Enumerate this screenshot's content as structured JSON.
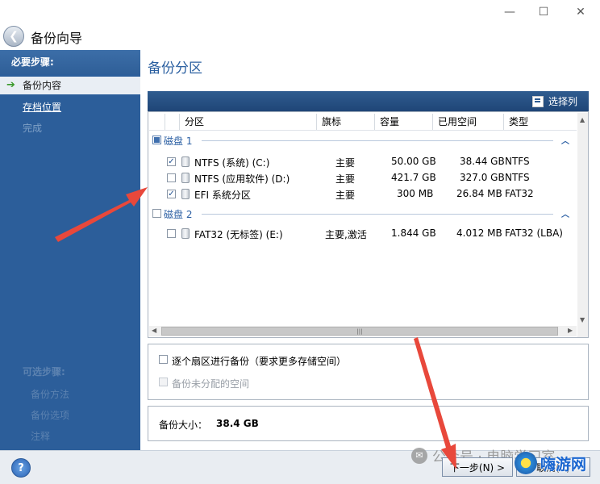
{
  "window": {
    "title": "备份向导",
    "controls": {
      "minimize": "—",
      "maximize": "☐",
      "close": "✕"
    },
    "back_icon": "back-arrow-icon"
  },
  "sidebar": {
    "required_steps_label": "必要步骤:",
    "items": [
      {
        "label": "备份内容",
        "state": "active"
      },
      {
        "label": "存档位置",
        "state": "link"
      },
      {
        "label": "完成",
        "state": "disabled"
      }
    ],
    "optional_steps_label": "可选步骤:",
    "optional_items": [
      {
        "label": "备份方法"
      },
      {
        "label": "备份选项"
      },
      {
        "label": "注释"
      }
    ],
    "help_label": "?"
  },
  "main": {
    "title": "备份分区",
    "select_columns_label": "选择列",
    "columns": [
      "分区",
      "旗标",
      "容量",
      "已用空间",
      "类型"
    ],
    "disks": [
      {
        "label": "磁盘 1",
        "state": "partial",
        "partitions": [
          {
            "checked": true,
            "name": "NTFS (系统) (C:)",
            "flags": "主要",
            "capacity": "50.00 GB",
            "used": "38.44 GB",
            "type": "NTFS"
          },
          {
            "checked": false,
            "name": "NTFS (应用软件) (D:)",
            "flags": "主要",
            "capacity": "421.7 GB",
            "used": "327.0 GB",
            "type": "NTFS"
          },
          {
            "checked": true,
            "name": "EFI 系统分区",
            "flags": "主要",
            "capacity": "300 MB",
            "used": "26.84 MB",
            "type": "FAT32"
          }
        ]
      },
      {
        "label": "磁盘 2",
        "state": "unchecked",
        "partitions": [
          {
            "checked": false,
            "name": "FAT32 (无标签) (E:)",
            "flags": "主要,激活",
            "capacity": "1.844 GB",
            "used": "4.012 MB",
            "type": "FAT32 (LBA)"
          }
        ]
      }
    ],
    "options": {
      "sector_by_sector": "逐个扇区进行备份（要求更多存储空间）",
      "unallocated": "备份未分配的空间"
    },
    "backup_size_label": "备份大小：",
    "backup_size_value": "38.4 GB"
  },
  "footer": {
    "next_button": "下一步(N) >",
    "cancel_button": "取消(C)",
    "watermark": "公众号 · 电脑学习室",
    "brand": "嗨游网"
  },
  "colors": {
    "sidebar": "#2c5e9a",
    "accent": "#2a5fa0",
    "arrow": "#e8483b"
  }
}
